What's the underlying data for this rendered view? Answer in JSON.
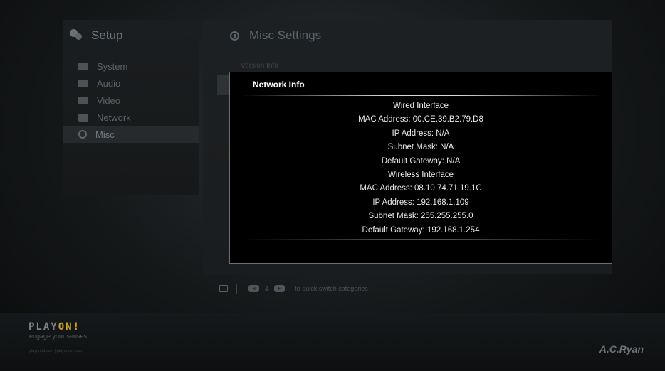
{
  "setup": {
    "title": "Setup",
    "menu": [
      {
        "label": "System",
        "icon": "system-icon"
      },
      {
        "label": "Audio",
        "icon": "audio-icon"
      },
      {
        "label": "Video",
        "icon": "video-icon"
      },
      {
        "label": "Network",
        "icon": "network-icon"
      },
      {
        "label": "Misc",
        "icon": "info-icon",
        "active": true
      }
    ]
  },
  "misc": {
    "title": "Misc Settings",
    "version_label": "Version Info"
  },
  "dialog": {
    "title": "Network Info",
    "wired": {
      "header": "Wired Interface",
      "mac": "MAC Address: 00.CE.39.B2.79.D8",
      "ip": "IP Address: N/A",
      "subnet": "Subnet Mask: N/A",
      "gateway": "Default Gateway: N/A"
    },
    "wireless": {
      "header": "Wireless Interface",
      "mac": "MAC Address: 08.10.74.71.19.1C",
      "ip": "IP Address: 192.168.1.109",
      "subnet": "Subnet Mask: 255.255.255.0",
      "gateway": "Default Gateway: 192.168.1.254"
    }
  },
  "hint": {
    "left_key": "◄",
    "amp": "&",
    "right_key": "►",
    "text": "to quick switch categories"
  },
  "branding": {
    "logo_a": "PLAY",
    "logo_b": "ON!",
    "tagline": "engage your senses",
    "urls": "playonhd.com | playondvr.com",
    "maker": "A.C.Ryan"
  },
  "colors": {
    "background": "#151819",
    "dialog_bg": "#000000",
    "dialog_text": "#e9e9e9",
    "logo_accent": "#c9a227"
  }
}
